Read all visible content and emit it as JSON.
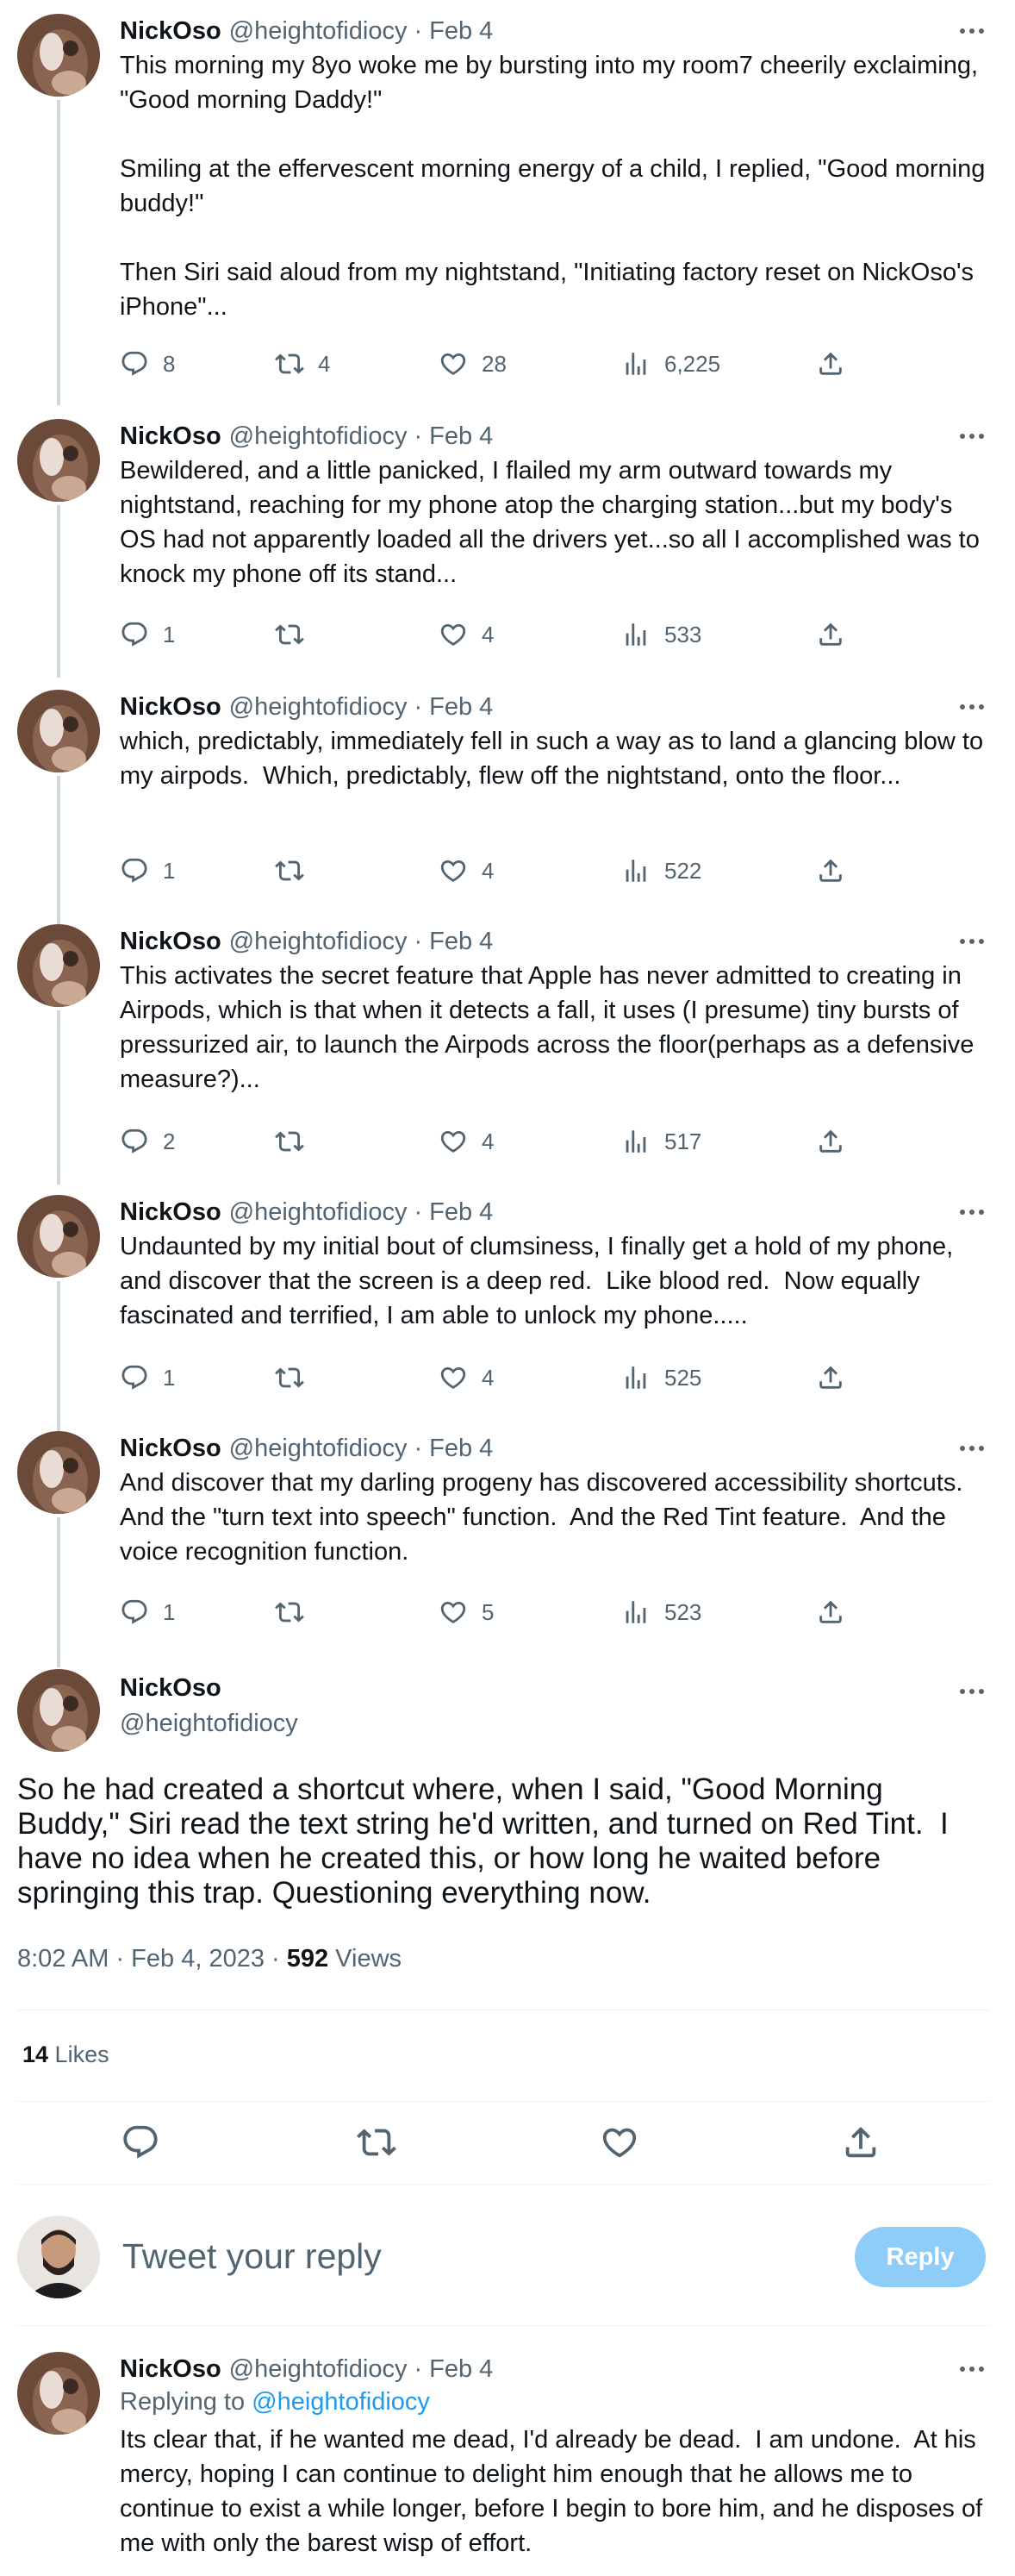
{
  "author": {
    "name": "NickOso",
    "handle": "@heightofidiocy"
  },
  "thread": [
    {
      "date": "Feb 4",
      "paragraphs": [
        "This morning my 8yo woke me by bursting into my room7 cheerily exclaiming, \"Good morning Daddy!\"",
        "Smiling at the effervescent morning energy of a child, I replied, \"Good morning buddy!\"",
        "Then Siri said aloud from my nightstand, \"Initiating factory reset on NickOso's iPhone\"..."
      ],
      "replies": "8",
      "retweets": "4",
      "likes": "28",
      "views": "6,225"
    },
    {
      "date": "Feb 4",
      "paragraphs": [
        "Bewildered, and a little panicked, I flailed my arm outward towards my nightstand, reaching for my phone atop the charging station...but my body's OS had not apparently loaded all the drivers yet...so all I accomplished was to knock my phone off its stand..."
      ],
      "replies": "1",
      "retweets": "",
      "likes": "4",
      "views": "533"
    },
    {
      "date": "Feb 4",
      "paragraphs": [
        "which, predictably, immediately fell in such a way as to land a glancing blow to my airpods.  Which, predictably, flew off the nightstand, onto the floor..."
      ],
      "replies": "1",
      "retweets": "",
      "likes": "4",
      "views": "522"
    },
    {
      "date": "Feb 4",
      "paragraphs": [
        "This activates the secret feature that Apple has never admitted to creating in Airpods, which is that when it detects a fall, it uses (I presume) tiny bursts of pressurized air, to launch the Airpods across the floor(perhaps as a defensive measure?)..."
      ],
      "replies": "2",
      "retweets": "",
      "likes": "4",
      "views": "517"
    },
    {
      "date": "Feb 4",
      "paragraphs": [
        "Undaunted by my initial bout of clumsiness, I finally get a hold of my phone, and discover that the screen is a deep red.  Like blood red.  Now equally fascinated and terrified, I am able to unlock my phone....."
      ],
      "replies": "1",
      "retweets": "",
      "likes": "4",
      "views": "525"
    },
    {
      "date": "Feb 4",
      "paragraphs": [
        "And discover that my darling progeny has discovered accessibility shortcuts.  And the \"turn text into speech\" function.  And the Red Tint feature.  And the voice recognition function."
      ],
      "replies": "1",
      "retweets": "",
      "likes": "5",
      "views": "523"
    }
  ],
  "main_tweet": {
    "text": "So he had created a shortcut where, when I said, \"Good Morning Buddy,\" Siri read the text string he'd written, and turned on Red Tint.  I have no idea when he created this, or how long he waited before springing this trap. Questioning everything now.",
    "time": "8:02 AM · Feb 4, 2023 · ",
    "views_count": "592",
    "views_label": " Views",
    "likes_count": "14",
    "likes_label": " Likes"
  },
  "composer": {
    "placeholder": "Tweet your reply",
    "button": "Reply"
  },
  "reply": {
    "date": "Feb 4",
    "replying_to_prefix": "Replying to ",
    "replying_to_handle": "@heightofidiocy",
    "text": "Its clear that, if he wanted me dead, I'd already be dead.  I am undone.  At his mercy, hoping I can continue to delight him enough that he allows me to continue to exist a while longer, before I begin to bore him, and he disposes of me with only the barest wisp of effort."
  },
  "colors": {
    "text": "#0f1419",
    "secondary": "#536471",
    "link": "#1d9bf0",
    "thread_line": "#cfd9de",
    "reply_button": "#8ecdf8"
  },
  "icons": [
    "more-icon",
    "reply-icon",
    "retweet-icon",
    "like-icon",
    "views-icon",
    "share-icon"
  ]
}
